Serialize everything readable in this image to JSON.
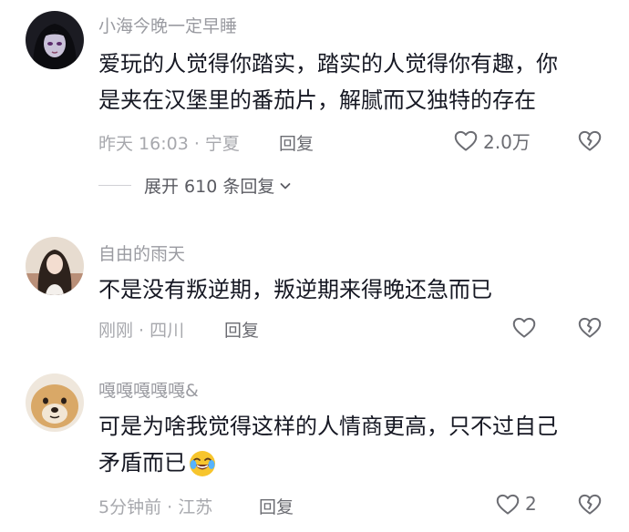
{
  "comments": [
    {
      "username": "小海今晚一定早睡",
      "text_lines": [
        "爱玩的人觉得你踏实，踏实的人觉得你有趣，你",
        "是夹在汉堡里的番茄片，解腻而又独特的存在"
      ],
      "time_location": "昨天 16:03 · 宁夏",
      "reply_label": "回复",
      "like_count": "2.0万",
      "expand_label": "展开 610 条回复"
    },
    {
      "username": "自由的雨天",
      "text_lines": [
        "不是没有叛逆期，叛逆期来得晚还急而已"
      ],
      "time_location": "刚刚 · 四川",
      "reply_label": "回复",
      "like_count": ""
    },
    {
      "username": "嘎嘎嘎嘎嘎&",
      "text_lines": [
        "可是为啥我觉得这样的人情商更高，只不过自己",
        "矛盾而已"
      ],
      "time_location": "5分钟前 · 江苏",
      "reply_label": "回复",
      "like_count": "2"
    }
  ],
  "icons": {
    "like": "heart-outline-icon",
    "dislike": "broken-heart-icon",
    "expand": "chevron-down-icon",
    "emoji": "crying-laughing-emoji"
  },
  "colors": {
    "username": "#9a9ba1",
    "text": "#161823",
    "meta": "#a7a8ad"
  }
}
